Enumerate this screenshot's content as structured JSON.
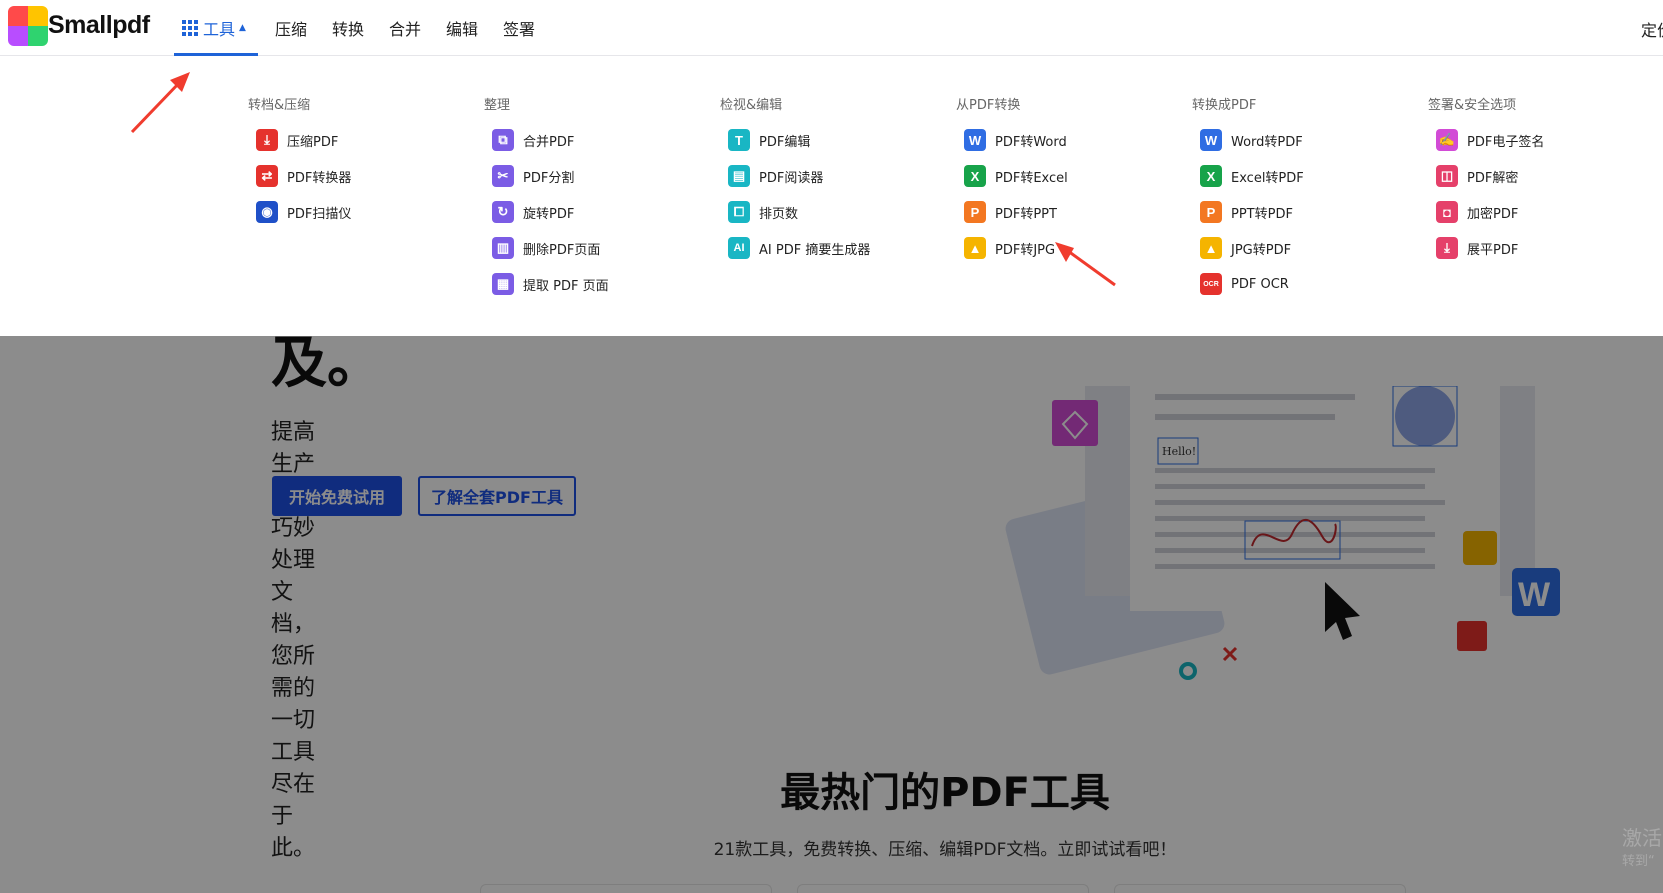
{
  "brand": {
    "name": "Smallpdf"
  },
  "nav": {
    "items": [
      {
        "label": "工具",
        "active": true
      },
      {
        "label": "压缩"
      },
      {
        "label": "转换"
      },
      {
        "label": "合并"
      },
      {
        "label": "编辑"
      },
      {
        "label": "签署"
      }
    ],
    "right_label": "定价"
  },
  "menu": {
    "columns": [
      {
        "heading": "转档&压缩",
        "items": [
          {
            "label": "压缩PDF",
            "icon": "compress-icon",
            "color": "#e5322d"
          },
          {
            "label": "PDF转换器",
            "icon": "convert-icon",
            "color": "#e5322d"
          },
          {
            "label": "PDF扫描仪",
            "icon": "camera-icon",
            "color": "#1f50c8"
          }
        ]
      },
      {
        "heading": "整理",
        "items": [
          {
            "label": "合并PDF",
            "icon": "merge-icon",
            "color": "#7b5ce5"
          },
          {
            "label": "PDF分割",
            "icon": "scissors-icon",
            "color": "#7b5ce5"
          },
          {
            "label": "旋转PDF",
            "icon": "rotate-icon",
            "color": "#7b5ce5"
          },
          {
            "label": "删除PDF页面",
            "icon": "trash-icon",
            "color": "#7b5ce5"
          },
          {
            "label": "提取 PDF 页面",
            "icon": "extract-icon",
            "color": "#7b5ce5"
          }
        ]
      },
      {
        "heading": "检视&编辑",
        "items": [
          {
            "label": "PDF编辑",
            "icon": "text-edit-icon",
            "color": "#19b6c4"
          },
          {
            "label": "PDF阅读器",
            "icon": "reader-icon",
            "color": "#19b6c4"
          },
          {
            "label": "排页数",
            "icon": "page-number-icon",
            "color": "#19b6c4"
          },
          {
            "label": "AI PDF 摘要生成器",
            "icon": "ai-icon",
            "color": "#19b6c4"
          }
        ]
      },
      {
        "heading": "从PDF转换",
        "items": [
          {
            "label": "PDF转Word",
            "icon": "word-icon",
            "color": "#2f6de3"
          },
          {
            "label": "PDF转Excel",
            "icon": "excel-icon",
            "color": "#17a34a"
          },
          {
            "label": "PDF转PPT",
            "icon": "ppt-icon",
            "color": "#f37721"
          },
          {
            "label": "PDF转JPG",
            "icon": "image-icon",
            "color": "#f5b400"
          }
        ]
      },
      {
        "heading": "转换成PDF",
        "items": [
          {
            "label": "Word转PDF",
            "icon": "word-icon",
            "color": "#2f6de3"
          },
          {
            "label": "Excel转PDF",
            "icon": "excel-icon",
            "color": "#17a34a"
          },
          {
            "label": "PPT转PDF",
            "icon": "ppt-icon",
            "color": "#f37721"
          },
          {
            "label": "JPG转PDF",
            "icon": "image-icon",
            "color": "#f5b400"
          },
          {
            "label": "PDF OCR",
            "icon": "ocr-icon",
            "color": "#e5322d"
          }
        ]
      },
      {
        "heading": "签署&安全选项",
        "items": [
          {
            "label": "PDF电子签名",
            "icon": "signature-icon",
            "color": "#d24bd6"
          },
          {
            "label": "PDF解密",
            "icon": "unlock-icon",
            "color": "#e5406a"
          },
          {
            "label": "加密PDF",
            "icon": "lock-icon",
            "color": "#e5406a"
          },
          {
            "label": "展平PDF",
            "icon": "flatten-icon",
            "color": "#e5406a"
          }
        ]
      }
    ]
  },
  "hero": {
    "title_fragment": "及。",
    "subtitle": "提高生产力、巧妙处理文档，您所需的一切工具尽在于此。",
    "primary_button": "开始免费试用",
    "secondary_button": "了解全套PDF工具",
    "illustration_text": "Hello!"
  },
  "popular": {
    "title": "最热门的PDF工具",
    "subtitle": "21款工具，免费转换、压缩、编辑PDF文档。立即试试看吧！"
  },
  "watermark": {
    "line1": "激活",
    "line2": "转到“"
  }
}
